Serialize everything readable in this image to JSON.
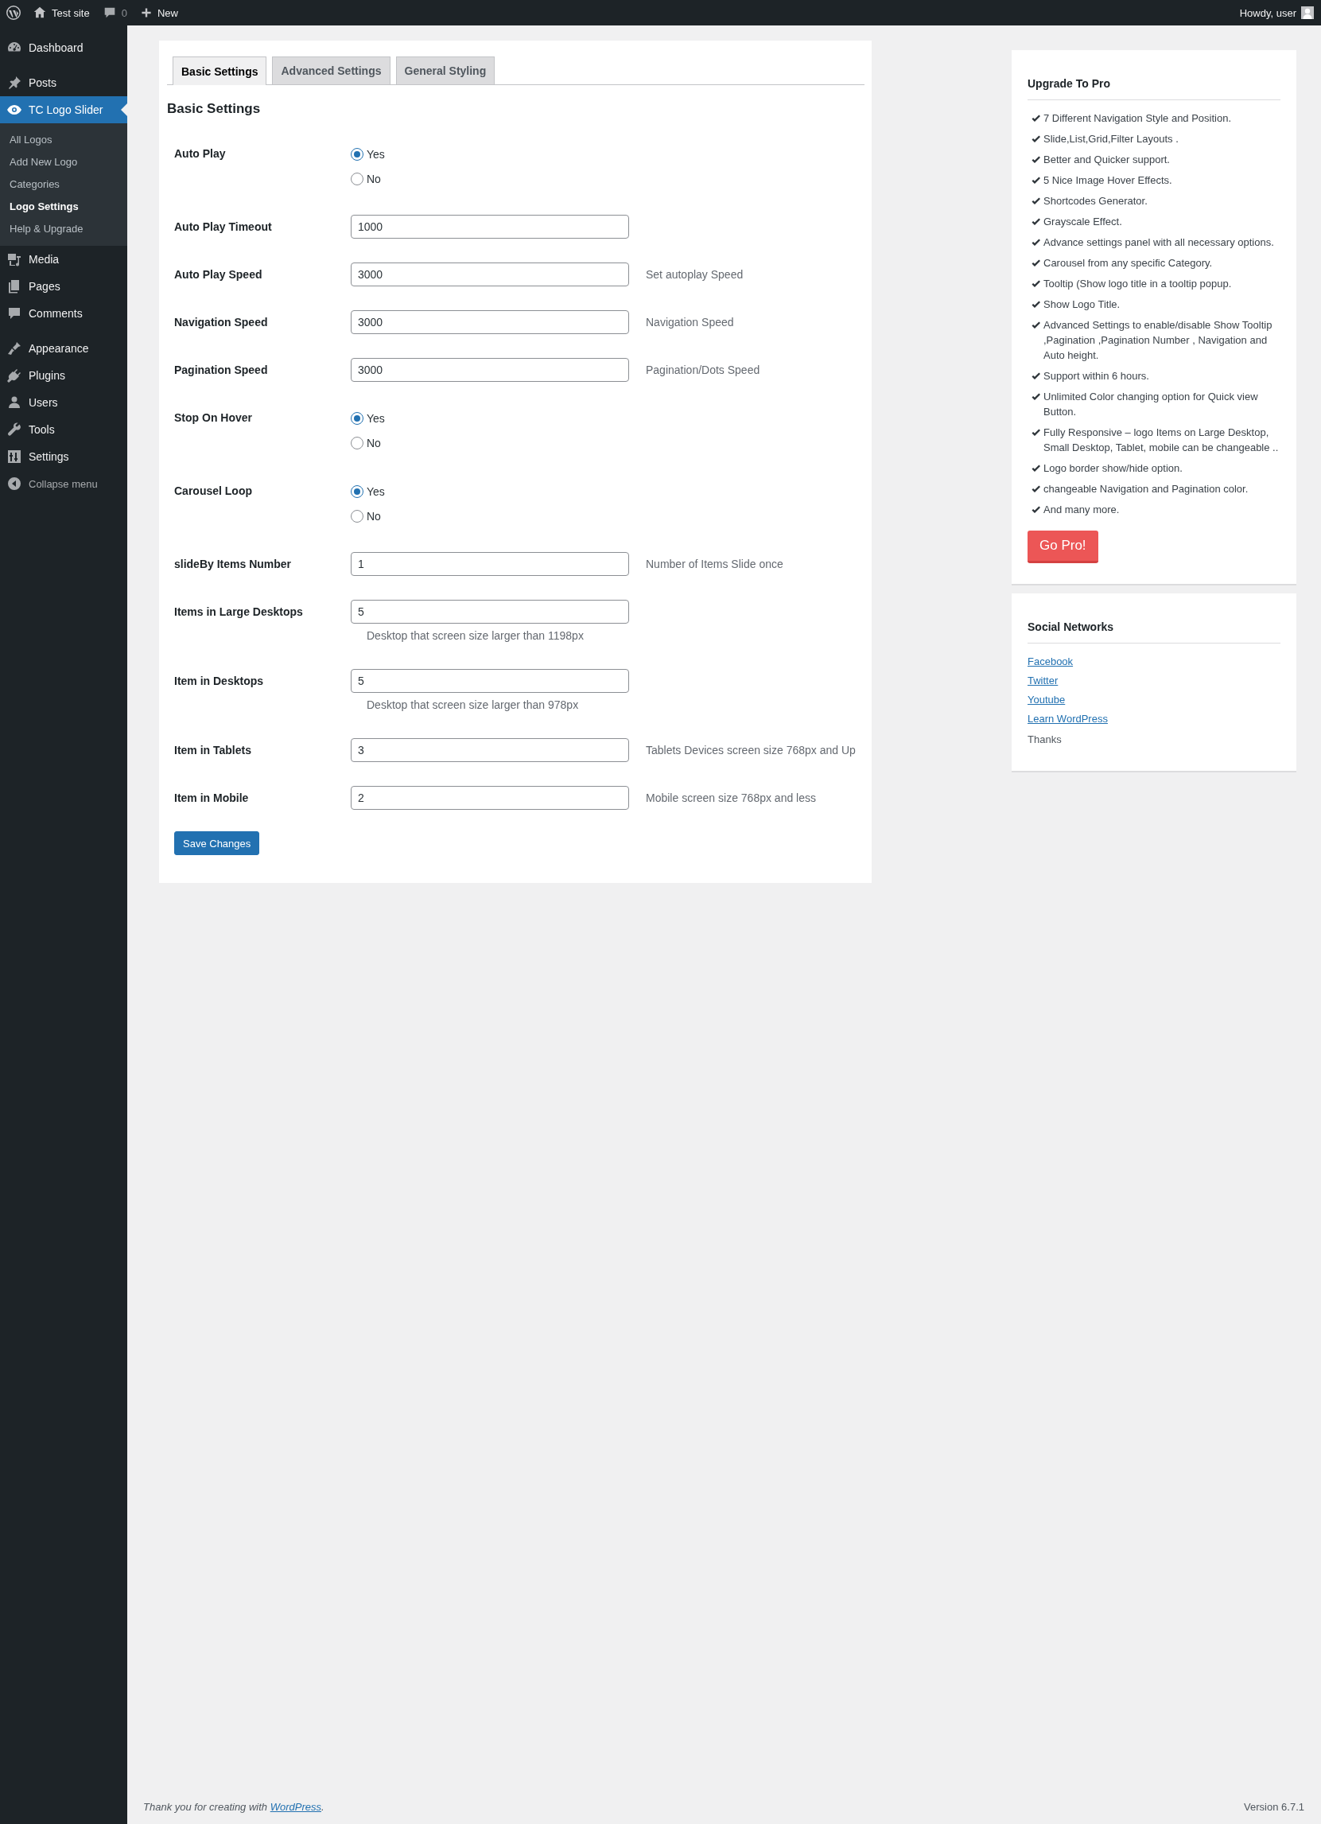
{
  "admin_bar": {
    "site": "Test site",
    "comments": "0",
    "new": "New",
    "greeting": "Howdy, user"
  },
  "sidebar": {
    "menu_groups": [
      [
        {
          "label": "Dashboard",
          "selected": false
        }
      ],
      [
        {
          "label": "Posts",
          "selected": false
        },
        {
          "label": "TC Logo Slider",
          "selected": true,
          "children": [
            {
              "label": "All Logos",
              "selected": false
            },
            {
              "label": "Add New Logo",
              "selected": false
            },
            {
              "label": "Categories",
              "selected": false
            },
            {
              "label": "Logo Settings",
              "selected": true
            },
            {
              "label": "Help & Upgrade",
              "selected": false
            }
          ]
        },
        {
          "label": "Media",
          "selected": false
        },
        {
          "label": "Pages",
          "selected": false
        },
        {
          "label": "Comments",
          "selected": false
        }
      ],
      [
        {
          "label": "Appearance",
          "selected": false
        },
        {
          "label": "Plugins",
          "selected": false
        },
        {
          "label": "Users",
          "selected": false
        },
        {
          "label": "Tools",
          "selected": false
        },
        {
          "label": "Settings",
          "selected": false
        }
      ]
    ],
    "collapse": "Collapse menu"
  },
  "settings": {
    "tabs": [
      {
        "label": "Basic Settings",
        "selected": true
      },
      {
        "label": "Advanced Settings",
        "selected": false
      },
      {
        "label": "General Styling",
        "selected": false
      }
    ],
    "section_title": "Basic Settings",
    "fields": [
      {
        "kind": "radio",
        "label": "Auto Play",
        "options": [
          {
            "label": "Yes",
            "selected": true
          },
          {
            "label": "No",
            "selected": false
          }
        ]
      },
      {
        "kind": "text",
        "label": "Auto Play Timeout",
        "value": "1000"
      },
      {
        "kind": "text",
        "label": "Auto Play Speed",
        "value": "3000",
        "description": "Set autoplay Speed"
      },
      {
        "kind": "text",
        "label": "Navigation Speed",
        "value": "3000",
        "description": "Navigation Speed"
      },
      {
        "kind": "text",
        "label": "Pagination Speed",
        "value": "3000",
        "description": "Pagination/Dots Speed"
      },
      {
        "kind": "radio",
        "label": "Stop On Hover",
        "options": [
          {
            "label": "Yes",
            "selected": true
          },
          {
            "label": "No",
            "selected": false
          }
        ]
      },
      {
        "kind": "radio",
        "label": "Carousel Loop",
        "options": [
          {
            "label": "Yes",
            "selected": true
          },
          {
            "label": "No",
            "selected": false
          }
        ]
      },
      {
        "kind": "text",
        "label": "slideBy Items Number",
        "value": "1",
        "description": "Number of Items Slide once"
      },
      {
        "kind": "text_stacked",
        "label": "Items in Large Desktops",
        "value": "5",
        "description": "Desktop that screen size larger than 1198px"
      },
      {
        "kind": "text_stacked",
        "label": "Item in Desktops",
        "value": "5",
        "description": "Desktop that screen size larger than 978px"
      },
      {
        "kind": "text",
        "label": "Item in Tablets",
        "value": "3",
        "description": "Tablets Devices screen size 768px and Up"
      },
      {
        "kind": "text",
        "label": "Item in Mobile",
        "value": "2",
        "description": "Mobile screen size 768px and less"
      }
    ],
    "save_button": "Save Changes"
  },
  "upgrade_panel": {
    "title": "Upgrade To Pro",
    "features": [
      "7 Different Navigation Style and Position.",
      "Slide,List,Grid,Filter Layouts .",
      "Better and Quicker support.",
      "5 Nice Image Hover Effects.",
      "Shortcodes Generator.",
      "Grayscale Effect.",
      "Advance settings panel with all necessary options.",
      "Carousel from any specific Category.",
      "Tooltip (Show logo title in a tooltip popup.",
      "Show Logo Title.",
      "Advanced Settings to enable/disable Show Tooltip ,Pagination ,Pagination Number , Navigation and Auto height.",
      "Support within 6 hours.",
      "Unlimited Color changing option for Quick view Button.",
      "Fully Responsive – logo Items on Large Desktop, Small Desktop, Tablet, mobile can be changeable ..",
      "Logo border show/hide option.",
      "changeable Navigation and Pagination color.",
      "And many more."
    ],
    "button": "Go Pro!"
  },
  "social_panel": {
    "title": "Social Networks",
    "links": [
      "Facebook",
      "Twitter",
      "Youtube",
      "Learn WordPress"
    ],
    "note": "Thanks"
  },
  "footer": {
    "text_before": "Thank you for creating with",
    "link": "WordPress",
    "text_after": ".",
    "version": "Version 6.7.1"
  }
}
